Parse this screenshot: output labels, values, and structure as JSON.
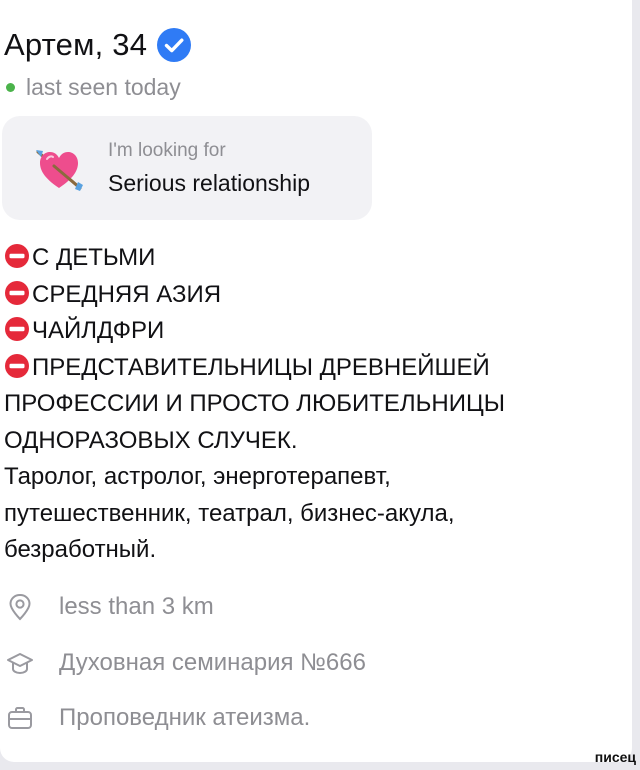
{
  "profile": {
    "name_age": "Артем, 34",
    "status": "last seen today"
  },
  "goal": {
    "caption": "I'm looking for",
    "value": "Serious relationship",
    "emoji": "heart-with-arrow"
  },
  "bio": {
    "lines": [
      "С ДЕТЬМИ",
      "СРЕДНЯЯ АЗИЯ",
      "ЧАЙЛДФРИ",
      "ПРЕДСТАВИТЕЛЬНИЦЫ ДРЕВНЕЙШЕЙ",
      "ПРОФЕССИИ И ПРОСТО ЛЮБИТЕЛЬНИЦЫ",
      "ОДНОРАЗОВЫХ СЛУЧЕК.",
      "Таролог, астролог, энерготерапевт,",
      "путешественник, театрал, бизнес-акула,",
      "безработный."
    ],
    "prohibited_icon": "no-entry-icon"
  },
  "details": {
    "distance": "less than 3 km",
    "education": "Духовная семинария №666",
    "job": "Проповедник атеизма."
  },
  "colors": {
    "verified": "#2f7bf5",
    "online": "#4bb34b",
    "secondary_text": "#8e8e93",
    "goal_background": "#f2f2f5",
    "no_entry": "#e5293a"
  },
  "watermark": "писец"
}
